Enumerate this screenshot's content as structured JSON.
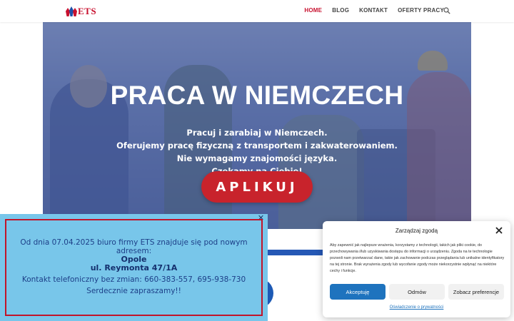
{
  "header": {
    "logo_text": "ETS",
    "nav": [
      "HOME",
      "BLOG",
      "KONTAKT",
      "OFERTY PRACY"
    ],
    "active_nav": "HOME",
    "search_icon": "search-icon"
  },
  "hero": {
    "title": "PRACA W NIEMCZECH",
    "lines": [
      "Pracuj i zarabiaj w Niemczech.",
      "Oferujemy pracę fizyczną z transportem i zakwaterowaniem.",
      "Nie wymagamy znajomości języka.",
      "Czekamy na Ciebie!"
    ],
    "button_label": "APLIKUJ"
  },
  "notice": {
    "close_icon": "close-icon",
    "line1": "Od dnia 07.04.2025 biuro firmy ETS znajduje się pod nowym",
    "line2": "adresem:",
    "city": "Opole",
    "street": "ul. Reymonta 47/1A",
    "phone_line": "Kontakt telefoniczny bez zmian: 660-383-557, 695-938-730",
    "closing": "Serdecznie zapraszamy!!"
  },
  "consent": {
    "title": "Zarządzaj zgodą",
    "close_icon": "close-icon",
    "text": "Aby zapewnić jak najlepsze wrażenia, korzystamy z technologii, takich jak pliki cookie, do przechowywania i/lub uzyskiwania dostępu do informacji o urządzeniu. Zgoda na te technologie pozwoli nam przetwarzać dane, takie jak zachowanie podczas przeglądania lub unikalne identyfikatory na tej stronie. Brak wyrażenia zgody lub wycofanie zgody może niekorzystnie wpłynąć na niektóre cechy i funkcje.",
    "accept": "Akceptuję",
    "deny": "Odmów",
    "preferences": "Zobacz preferencje",
    "policy_link": "Oświadczenie o prywatności"
  },
  "colors": {
    "brand_red": "#c8102e",
    "brand_blue": "#1d4fa8",
    "notice_bg": "#78c6ea",
    "accept_blue": "#1e73be"
  }
}
